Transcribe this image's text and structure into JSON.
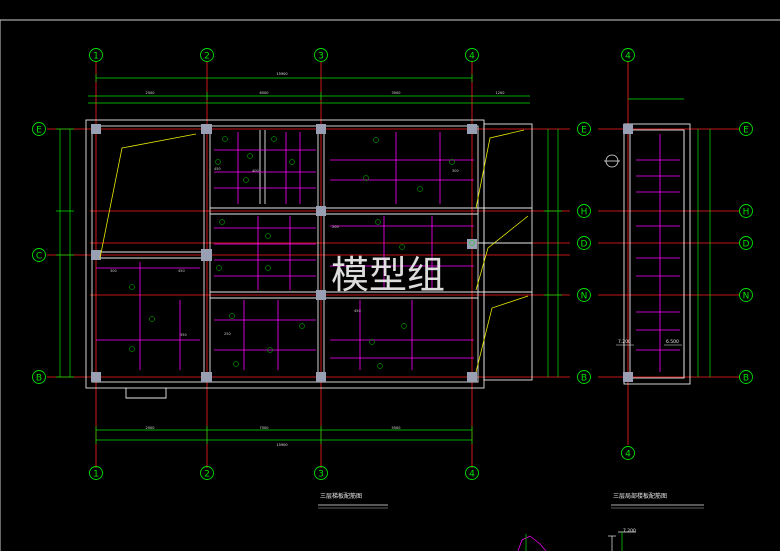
{
  "drawing": {
    "watermark": "模型组",
    "plan_title": "三层梯板配筋图",
    "section_title": "三层局部楼板配筋图",
    "axis_labels": {
      "cols": [
        "1",
        "2",
        "3",
        "4"
      ],
      "rows_main": [
        "E",
        "C",
        "B"
      ],
      "rows_right": [
        "E",
        "H",
        "D",
        "N",
        "B"
      ],
      "section_col": "4"
    },
    "elevations": [
      "7.200",
      "6.500",
      "7.200"
    ],
    "dims_top": [
      "2500",
      "6500",
      "3500",
      "1200",
      "15900"
    ],
    "dims_bottom": [
      "15900",
      "2500",
      "7500",
      "5500"
    ],
    "rebar_texts": [
      "450",
      "400",
      "300",
      "300",
      "450",
      "250",
      "350",
      "200",
      "200",
      "450"
    ]
  },
  "colors": {
    "background": "#000000",
    "grid_line": "#ff0000",
    "dim_line": "#00ff00",
    "wall": "#ffffff",
    "column": "#9aa0b4",
    "rebar": "#ff00ff",
    "stair": "#ffff00",
    "axis_bubble": "#00ff00"
  }
}
